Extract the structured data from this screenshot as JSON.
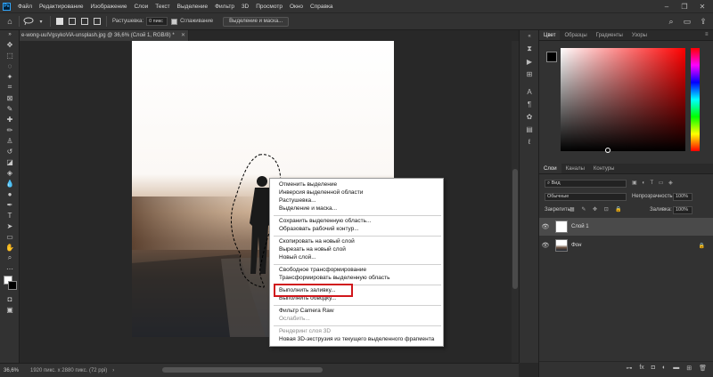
{
  "menubar": {
    "logo": "Ps",
    "items": [
      "Файл",
      "Редактирование",
      "Изображение",
      "Слои",
      "Текст",
      "Выделение",
      "Фильтр",
      "3D",
      "Просмотр",
      "Окно",
      "Справка"
    ]
  },
  "options": {
    "feather_label": "Растушевка:",
    "feather_value": "0 пикс",
    "antialias_label": "Сглаживание",
    "select_mask_btn": "Выделение и маска..."
  },
  "document": {
    "tab_title": "e-wong-uuIVgsykoViA-unsplash.jpg @ 36,6% (Слой 1, RGB/8) *"
  },
  "status": {
    "zoom": "36,6%",
    "doc_info": "1920 пикс. х 2880 пикс. (72 ppi)"
  },
  "color_panel": {
    "tabs": [
      "Цвет",
      "Образцы",
      "Градиенты",
      "Узоры"
    ],
    "hue_color": "#ff0000"
  },
  "layers_panel": {
    "tabs": [
      "Слои",
      "Каналы",
      "Контуры"
    ],
    "search_value": "Вид",
    "blend_mode": "Обычные",
    "opacity_label": "Непрозрачность:",
    "opacity_value": "100%",
    "lock_label": "Закрепить:",
    "fill_label": "Заливка:",
    "fill_value": "100%",
    "layers": [
      {
        "name": "Слой 1"
      },
      {
        "name": "Фон"
      }
    ]
  },
  "context_menu": {
    "items": [
      {
        "label": "Отменить выделение",
        "disabled": false
      },
      {
        "label": "Инверсия выделенной области",
        "disabled": false
      },
      {
        "label": "Растушевка...",
        "disabled": false
      },
      {
        "label": "Выделение и маска...",
        "disabled": false
      },
      {
        "label": "Сохранить выделенную область...",
        "disabled": false
      },
      {
        "label": "Образовать рабочий контур...",
        "disabled": false
      },
      {
        "label": "Скопировать на новый слой",
        "disabled": false
      },
      {
        "label": "Вырезать на новый слой",
        "disabled": false
      },
      {
        "label": "Новый слой...",
        "disabled": false
      },
      {
        "label": "Свободное трансформирование",
        "disabled": false
      },
      {
        "label": "Трансформировать выделенную область",
        "disabled": false
      },
      {
        "label": "Выполнить заливку...",
        "disabled": false
      },
      {
        "label": "Выполнить обводку...",
        "disabled": false
      },
      {
        "label": "Фильтр Camera Raw",
        "disabled": false
      },
      {
        "label": "Ослабить...",
        "disabled": true
      },
      {
        "label": "Рендеринг слоя 3D",
        "disabled": true
      },
      {
        "label": "Новая 3D-экструзия из текущего выделенного фрагмента",
        "disabled": false
      }
    ],
    "highlight_color": "#d0161b"
  }
}
